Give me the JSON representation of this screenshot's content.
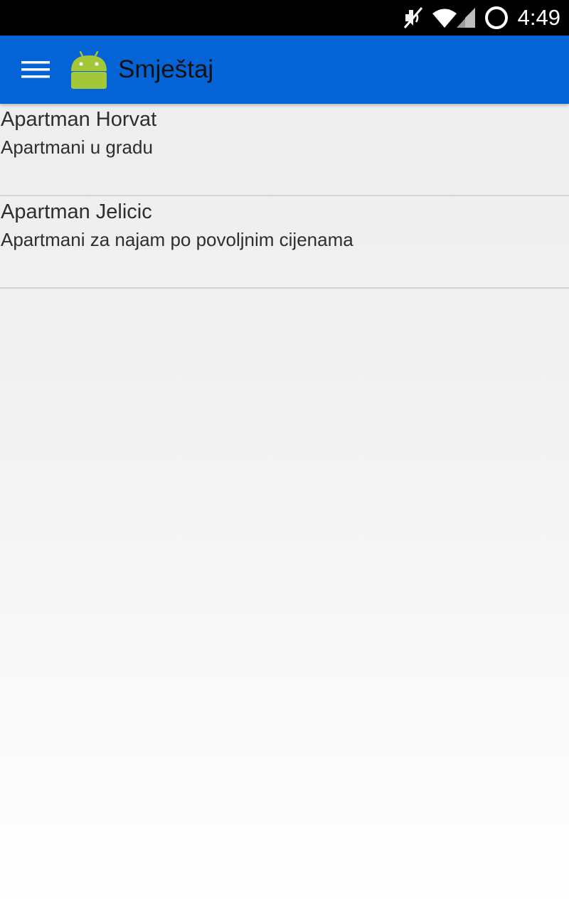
{
  "status_bar": {
    "time": "4:49",
    "icons": [
      "mute-icon",
      "wifi-icon",
      "signal-icon",
      "loading-circle-icon"
    ]
  },
  "action_bar": {
    "title": "Smještaj",
    "menu_icon": "hamburger-menu-icon",
    "logo_icon": "android-logo-icon",
    "background_color": "#0464d6"
  },
  "list": {
    "items": [
      {
        "title": "Apartman Horvat",
        "subtitle": "Apartmani u gradu"
      },
      {
        "title": "Apartman Jelicic",
        "subtitle": "Apartmani za najam po povoljnim cijenama"
      }
    ]
  }
}
